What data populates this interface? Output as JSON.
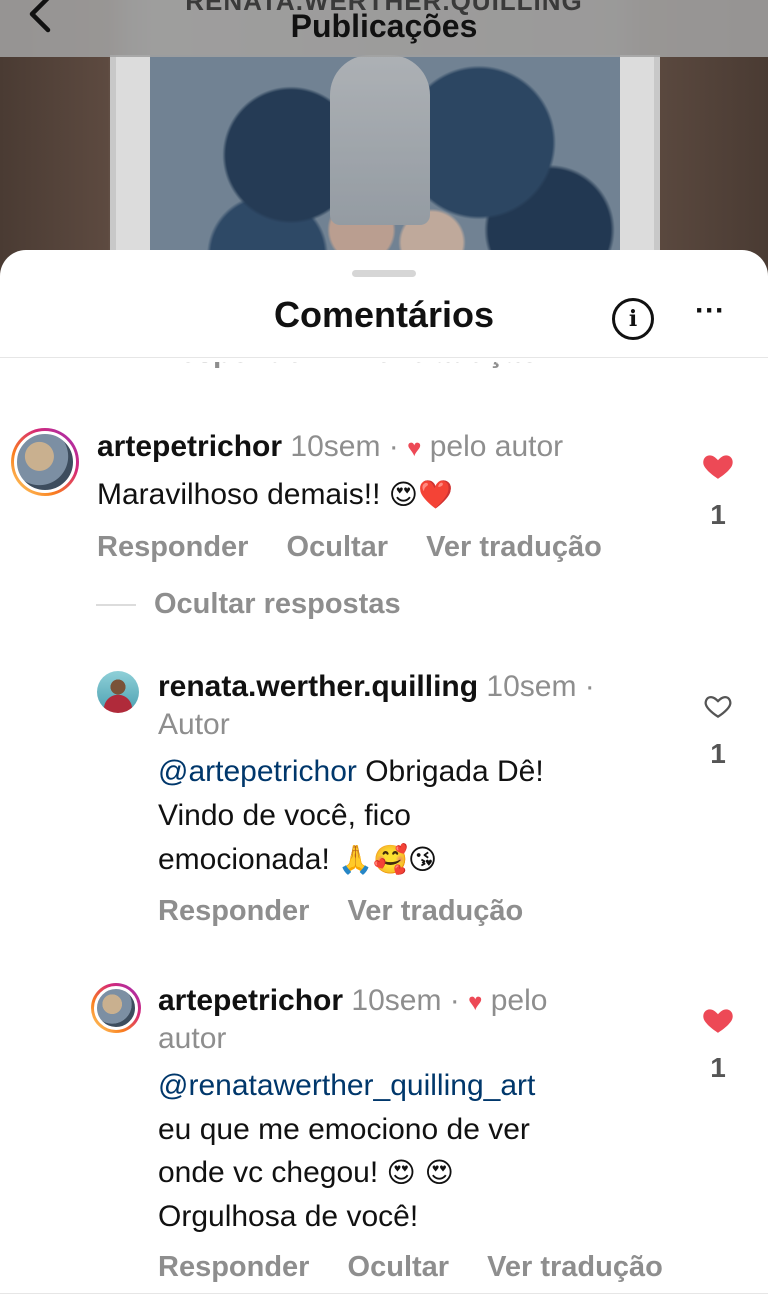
{
  "top_bar": {
    "subtitle": "RENATA.WERTHER.QUILLING",
    "title": "Publicações"
  },
  "sheet": {
    "title": "Comentários",
    "info_icon": "info-circle-icon",
    "more_icon": "more-horizontal-icon"
  },
  "clipped_actions": [
    "Responder",
    "Ver tradução"
  ],
  "comments": [
    {
      "username": "artepetrichor",
      "time": "10sem",
      "liked_by_author": "pelo autor",
      "text": "Maravilhoso demais!!",
      "emojis": "😍❤️",
      "liked": true,
      "like_count": "1",
      "actions": [
        "Responder",
        "Ocultar",
        "Ver tradução"
      ]
    }
  ],
  "replies_toggle": "Ocultar respostas",
  "replies": [
    {
      "username": "renata.werther.quilling",
      "time": "10sem",
      "author_badge": "Autor",
      "mention": "@artepetrichor",
      "text_lines": [
        "Obrigada Dê!",
        "Vindo de você, fico",
        "emocionada!"
      ],
      "emojis": "🙏🥰😘",
      "liked": false,
      "like_count": "1",
      "actions": [
        "Responder",
        "Ver tradução"
      ]
    },
    {
      "username": "artepetrichor",
      "time": "10sem",
      "liked_by_author_1": "pelo",
      "liked_by_author_2": "autor",
      "mention": "@renatawerther_quilling_art",
      "text_lines": [
        "eu que me emociono de ver",
        "onde vc chegou!",
        "Orgulhosa de você!"
      ],
      "emojis": "😍 😍",
      "liked": true,
      "like_count": "1",
      "actions": [
        "Responder",
        "Ocultar",
        "Ver tradução"
      ]
    }
  ],
  "colors": {
    "like_red": "#ed4956",
    "meta_gray": "#8e8e8e",
    "mention_blue": "#00376b"
  }
}
